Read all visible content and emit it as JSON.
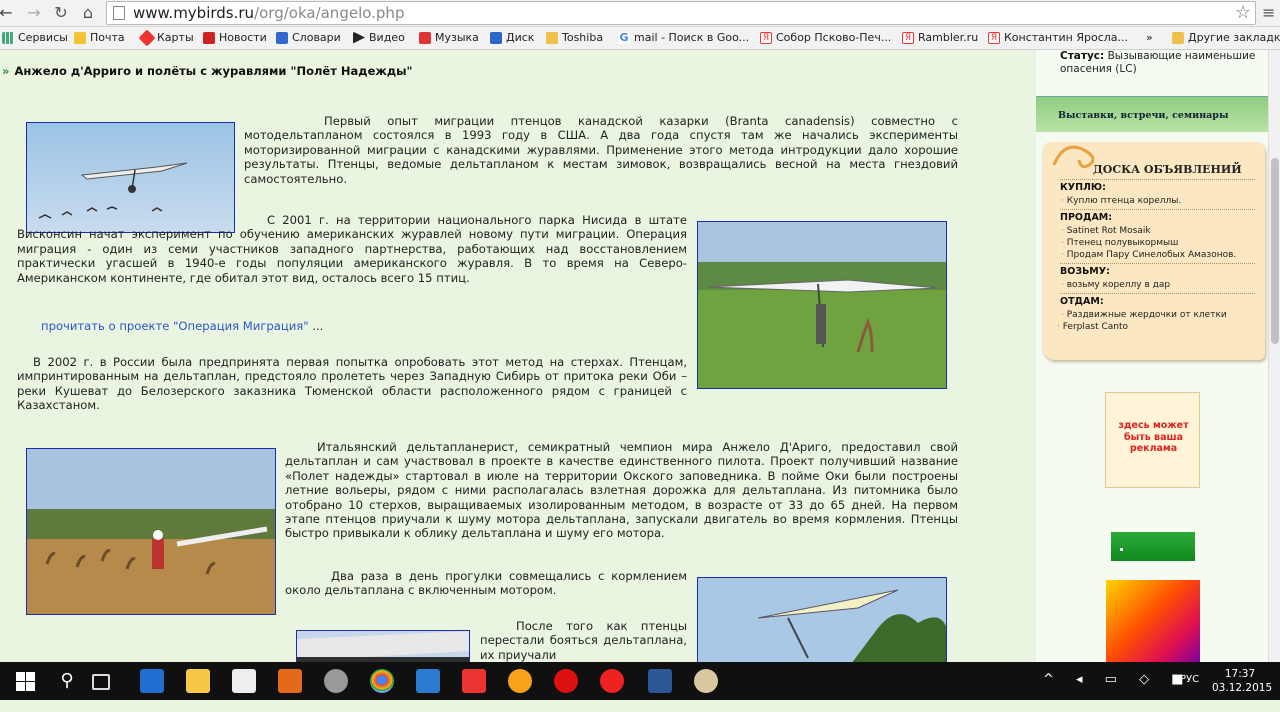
{
  "browser": {
    "url_host": "www.mybirds.ru",
    "url_path": "/org/oka/angelo.php"
  },
  "bookmarks": [
    {
      "label": "Сервисы",
      "icon": "apps-icon"
    },
    {
      "label": "Почта",
      "icon": "mail-icon"
    },
    {
      "label": "Карты",
      "icon": "maps-icon"
    },
    {
      "label": "Новости",
      "icon": "news-icon"
    },
    {
      "label": "Словари",
      "icon": "dictionary-icon"
    },
    {
      "label": "Видео",
      "icon": "video-icon"
    },
    {
      "label": "Музыка",
      "icon": "music-icon"
    },
    {
      "label": "Диск",
      "icon": "disk-icon"
    },
    {
      "label": "Toshiba",
      "icon": "folder-icon"
    },
    {
      "label": "mail - Поиск в Goo...",
      "icon": "google-icon"
    },
    {
      "label": "Собор Псково-Печ...",
      "icon": "yandex-icon"
    },
    {
      "label": "Rambler.ru",
      "icon": "yandex-icon"
    },
    {
      "label": "Константин Яросла...",
      "icon": "yandex-icon"
    },
    {
      "label": "»",
      "icon": ""
    },
    {
      "label": "Другие закладки",
      "icon": "folder-icon"
    }
  ],
  "article": {
    "title": "Анжело д'Арриго и полёты с журавлями \"Полёт Надежды\"",
    "p1": "Первый опыт миграции птенцов канадской казарки (Branta canadensis) совместно с мотодельтапланом состоялся в 1993 году в США. А два года спустя там же начались эксперименты моторизированной миграции с канадскими журавлями. Применение этого метода интродукции дало хорошие результаты. Птенцы, ведомые дельтапланом к местам зимовок, возвращались весной на места гнездовий самостоятельно.",
    "p2": "С 2001 г. на территории национального парка Нисида в штате Висконсин начат эксперимент по обучению американских журавлей новому пути миграции. Операция миграция - один из семи участников западного партнерства, работающих над восстановлением практически угасшей в 1940-е годы популяции американского журавля. В то время на Северо-Американском континенте, где обитал этот вид, осталось всего 15 птиц.",
    "read_link": "прочитать о проекте \"Операция Миграция\"",
    "read_dots": "...",
    "p3": "В 2002 г. в России была предпринята первая попытка опробовать этот метод на стерхах. Птенцам, импринтированным на дельтаплан, предстояло пролететь через Западную Сибирь от притока реки Оби – реки Кушеват до Белозерского заказника Тюменской области расположенного  рядом с  границей с Казахстаном.",
    "p4": "Итальянский дельтапланерист, семикратный чемпион мира Анжело Д'Ариго, предоставил свой дельтаплан и сам участвовал в проекте в качестве единственного пилота. Проект получивший название «Полет надежды» стартовал в июле на территории Окского заповедника. В пойме Оки были построены летние вольеры, рядом с ними располагалась взлетная дорожка для дельтаплана. Из питомника было отобрано 10 стерхов, выращиваемых изолированным методом, в возрасте от 33 до 65 дней. На первом этапе птенцов приучали к шуму мотора дельтаплана, запускали двигатель во время кормления. Птенцы быстро привыкали к облику дельтаплана и шуму его мотора.",
    "p5": "Два раза в день прогулки совмещались с кормлением около дельтаплана с включенным мотором.",
    "p6": "После того как птенцы перестали бояться дельтаплана, их приучали"
  },
  "sidebar": {
    "status_label": "Статус:",
    "status_value": "Вызывающие наименьшие опасения (LC)",
    "events_label": "Выставки, встречи, семинары",
    "board": {
      "title": "ДОСКА ОБЪЯВЛЕНИЙ",
      "buy_label": "КУПЛЮ:",
      "buy_items": [
        "Куплю птенца кореллы."
      ],
      "sell_label": "ПРОДАМ:",
      "sell_items": [
        "Satinet Rot Mosaik",
        "Птенец полувыкормыш",
        "Продам Пару Синелобых Амазонов."
      ],
      "take_label": "ВОЗЬМУ:",
      "take_items": [
        "возьму кореллу в дар"
      ],
      "give_label": "ОТДАМ:",
      "give_items": [
        "Раздвижные жердочки от клетки",
        "Ferplast Canto"
      ]
    },
    "ad_text": "здесь может быть ваша реклама"
  },
  "taskbar": {
    "lang": "РУС",
    "time": "17:37",
    "date": "03.12.2015"
  },
  "colors": {
    "page_bg": "#e9f5e1",
    "link": "#2b56c8",
    "photo_border": "#1b2ea8",
    "ad_text": "#dd2222"
  }
}
